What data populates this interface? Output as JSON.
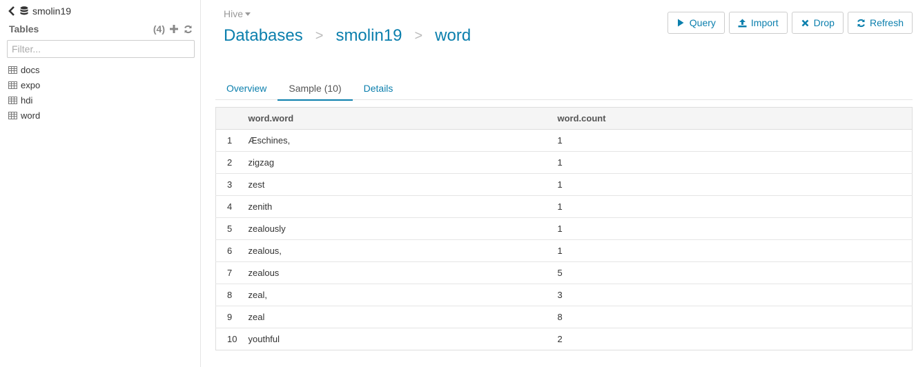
{
  "sidebar": {
    "db_name": "smolin19",
    "tables_title": "Tables",
    "tables_count": "(4)",
    "filter_placeholder": "Filter...",
    "tables": [
      {
        "label": "docs"
      },
      {
        "label": "expo"
      },
      {
        "label": "hdi"
      },
      {
        "label": "word"
      }
    ]
  },
  "header": {
    "engine": "Hive",
    "breadcrumbs": [
      "Databases",
      "smolin19",
      "word"
    ],
    "actions": {
      "query": "Query",
      "import": "Import",
      "drop": "Drop",
      "refresh": "Refresh"
    }
  },
  "tabs": [
    {
      "label": "Overview",
      "active": false
    },
    {
      "label": "Sample (10)",
      "active": true
    },
    {
      "label": "Details",
      "active": false
    }
  ],
  "sample": {
    "columns": [
      "",
      "word.word",
      "word.count"
    ],
    "rows": [
      [
        "1",
        "Æschines,",
        "1"
      ],
      [
        "2",
        "zigzag",
        "1"
      ],
      [
        "3",
        "zest",
        "1"
      ],
      [
        "4",
        "zenith",
        "1"
      ],
      [
        "5",
        "zealously",
        "1"
      ],
      [
        "6",
        "zealous,",
        "1"
      ],
      [
        "7",
        "zealous",
        "5"
      ],
      [
        "8",
        "zeal,",
        "3"
      ],
      [
        "9",
        "zeal",
        "8"
      ],
      [
        "10",
        "youthful",
        "2"
      ]
    ]
  },
  "colors": {
    "link": "#0b7fad",
    "muted": "#999999"
  }
}
